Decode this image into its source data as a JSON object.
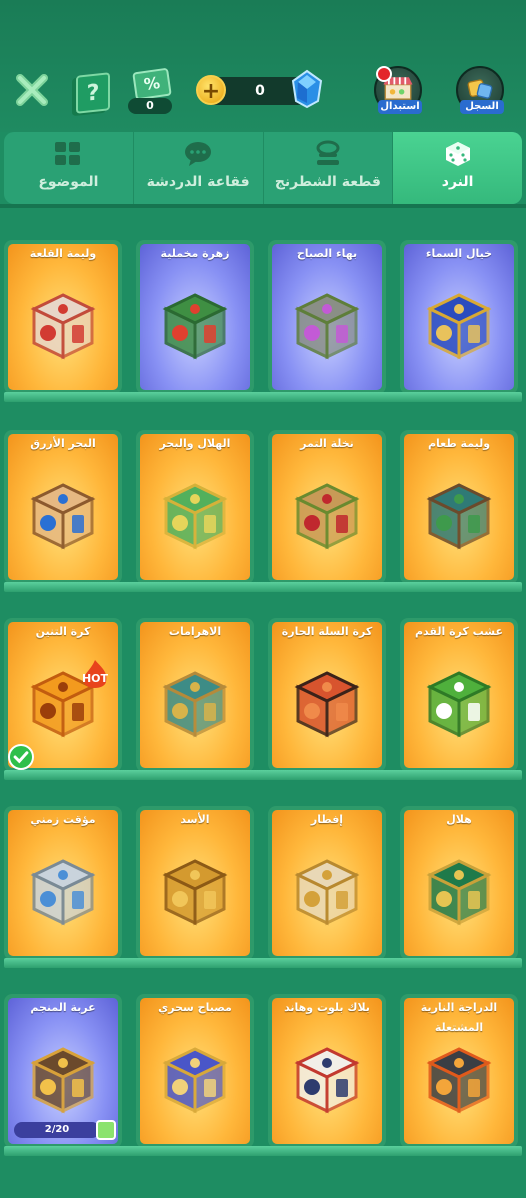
{
  "header": {
    "discount_symbol": "%",
    "discount_count": "0",
    "gems_amount": "0",
    "add_symbol": "+",
    "help_symbol": "?",
    "exchange_label": "استبدال",
    "record_label": "السجل"
  },
  "tabs": [
    {
      "label": "الموضوع",
      "icon": "theme-icon"
    },
    {
      "label": "فقاعة الدردشة",
      "icon": "chat-bubble-icon"
    },
    {
      "label": "قطعة الشطرنج",
      "icon": "chess-piece-icon"
    },
    {
      "label": "النرد",
      "icon": "dice-icon",
      "active": true
    }
  ],
  "rows": [
    {
      "cards": [
        {
          "title": "خيال السماء",
          "theme": "purple",
          "dice": {
            "face": "#2a4cbf",
            "trim": "#d8a933",
            "accent": "#e8c25c"
          }
        },
        {
          "title": "بهاء الصباح",
          "theme": "purple",
          "dice": {
            "face": "#8a8f86",
            "trim": "#5e7e3a",
            "accent": "#c35ad6"
          }
        },
        {
          "title": "زهرة مخملية",
          "theme": "purple",
          "dice": {
            "face": "#3f8f43",
            "trim": "#2b6a32",
            "accent": "#e0402f"
          }
        },
        {
          "title": "وليمة القلعة",
          "theme": "orange",
          "dice": {
            "face": "#e8d6c8",
            "trim": "#c24b3b",
            "accent": "#d23b32"
          }
        }
      ]
    },
    {
      "cards": [
        {
          "title": "وليمة طعام",
          "theme": "orange",
          "dice": {
            "face": "#2f7a76",
            "trim": "#6b4b2c",
            "accent": "#3e9a4c"
          }
        },
        {
          "title": "نخلة التمر",
          "theme": "orange",
          "dice": {
            "face": "#c89a57",
            "trim": "#6a8a2f",
            "accent": "#c0282e"
          }
        },
        {
          "title": "الهلال والبحر",
          "theme": "orange",
          "dice": {
            "face": "#52b05c",
            "trim": "#d5b23a",
            "accent": "#e6d55a"
          }
        },
        {
          "title": "البحر الأزرق",
          "theme": "orange",
          "dice": {
            "face": "#e6b882",
            "trim": "#8c5a2e",
            "accent": "#2a70d4"
          }
        }
      ]
    },
    {
      "cards": [
        {
          "title": "عشب كرة القدم",
          "theme": "orange",
          "dice": {
            "face": "#4fb03c",
            "trim": "#2e7a26",
            "accent": "#ffffff"
          }
        },
        {
          "title": "كرة السلة الحارة",
          "theme": "orange",
          "dice": {
            "face": "#d8542e",
            "trim": "#3b2219",
            "accent": "#f08a4a"
          }
        },
        {
          "title": "الاهرامات",
          "theme": "orange",
          "dice": {
            "face": "#3d8c86",
            "trim": "#b58a3a",
            "accent": "#d8b34a"
          }
        },
        {
          "title": "كرة التنين",
          "theme": "orange",
          "dice": {
            "face": "#f39a1e",
            "trim": "#c25c0f",
            "accent": "#9b3e0a"
          },
          "selected": true,
          "hot": "HOT"
        }
      ]
    },
    {
      "cards": [
        {
          "title": "هلال",
          "theme": "orange",
          "dice": {
            "face": "#1f7a4a",
            "trim": "#c9a23a",
            "accent": "#e6c452"
          }
        },
        {
          "title": "إفطار",
          "theme": "orange",
          "dice": {
            "face": "#e9d8b6",
            "trim": "#b8892f",
            "accent": "#d4a13a"
          }
        },
        {
          "title": "الأسد",
          "theme": "orange",
          "dice": {
            "face": "#d49a2f",
            "trim": "#8c5a16",
            "accent": "#f1c659"
          }
        },
        {
          "title": "مؤقت زمني",
          "theme": "orange",
          "dice": {
            "face": "#c9d3dc",
            "trim": "#7a8a96",
            "accent": "#4b8fd6"
          }
        }
      ]
    },
    {
      "cards": [
        {
          "title": "الدراجة النارية المشتعلة",
          "theme": "orange",
          "dice": {
            "face": "#3b3e44",
            "trim": "#e05a1c",
            "accent": "#f3a53a"
          }
        },
        {
          "title": "بلاك بلوت وهاند",
          "theme": "orange",
          "dice": {
            "face": "#f2efe8",
            "trim": "#c2392f",
            "accent": "#2d3b6e"
          }
        },
        {
          "title": "مصباح سحري",
          "theme": "orange",
          "dice": {
            "face": "#4a56c8",
            "trim": "#d8a93a",
            "accent": "#f1d27a"
          }
        },
        {
          "title": "عربة المنجم",
          "theme": "purple",
          "dice": {
            "face": "#6b4a2c",
            "trim": "#d8a23a",
            "accent": "#f2c14a"
          },
          "progress": "2/20"
        }
      ]
    }
  ]
}
